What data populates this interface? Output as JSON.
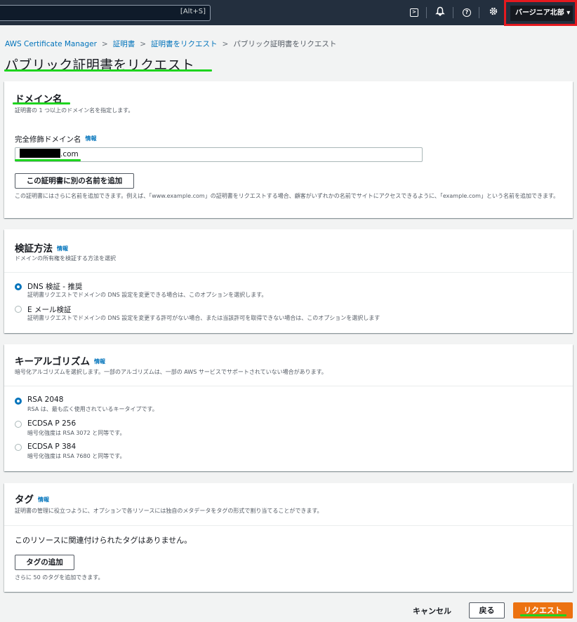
{
  "topbar": {
    "search_shortcut": "[Alt+S]",
    "icons": [
      "cloudshell-icon",
      "notifications-icon",
      "help-icon",
      "settings-icon"
    ],
    "region": "バージニア北部 ▾"
  },
  "breadcrumb": {
    "items": [
      "AWS Certificate Manager",
      "証明書",
      "証明書をリクエスト"
    ],
    "separator": ">",
    "current": "パブリック証明書をリクエスト"
  },
  "page": {
    "title": "パブリック証明書をリクエスト"
  },
  "domain_panel": {
    "title": "ドメイン名",
    "description": "証明書の 1 つ以上のドメイン名を指定します。",
    "field_label": "完全修飾ドメイン名",
    "info": "情報",
    "domain_suffix": ".com",
    "add_name_button": "この証明書に別の名前を追加",
    "hint": "この証明書にはさらに名前を追加できます。例えば、「www.example.com」の証明書をリクエストする場合、顧客がいずれかの名前でサイトにアクセスできるように、「example.com」という名前を追加できます。"
  },
  "validation_panel": {
    "title": "検証方法",
    "info": "情報",
    "description": "ドメインの所有権を検証する方法を選択",
    "options": [
      {
        "label": "DNS 検証 - 推奨",
        "description": "証明書リクエストでドメインの DNS 設定を変更できる場合は、このオプションを選択します。",
        "selected": true
      },
      {
        "label": "E メール検証",
        "description": "証明書リクエストでドメインの DNS 設定を変更する許可がない場合、または当該許可を取得できない場合は、このオプションを選択します",
        "selected": false
      }
    ]
  },
  "algorithm_panel": {
    "title": "キーアルゴリズム",
    "info": "情報",
    "description": "暗号化アルゴリズムを選択します。一部のアルゴリズムは、一部の AWS サービスでサポートされていない場合があります。",
    "options": [
      {
        "label": "RSA 2048",
        "description": "RSA は、最も広く使用されているキータイプです。",
        "selected": true
      },
      {
        "label": "ECDSA P 256",
        "description": "暗号化強度は RSA 3072 と同等です。",
        "selected": false
      },
      {
        "label": "ECDSA P 384",
        "description": "暗号化強度は RSA 7680 と同等です。",
        "selected": false
      }
    ]
  },
  "tags_panel": {
    "title": "タグ",
    "info": "情報",
    "description": "証明書の管理に役立つように、オプションで各リソースには独自のメタデータをタグの形式で割り当てることができます。",
    "empty_text": "このリソースに関連付けられたタグはありません。",
    "add_tag_button": "タグの追加",
    "hint": "さらに 50 のタグを追加できます。"
  },
  "footer": {
    "cancel": "キャンセル",
    "back": "戻る",
    "submit": "リクエスト"
  },
  "colors": {
    "topbar": "#232f3e",
    "link": "#0073bb",
    "primary_button": "#ec7211",
    "annotation_green": "#1ed41e",
    "annotation_red": "#e5191f"
  }
}
